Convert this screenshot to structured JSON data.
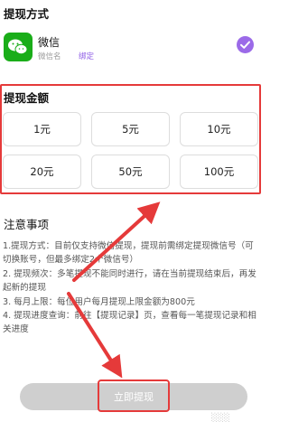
{
  "method": {
    "title": "提现方式",
    "wechat_label": "微信",
    "wechat_sub": "微信名",
    "bound_tag": "绑定"
  },
  "amount": {
    "title": "提现金额",
    "options": [
      "1元",
      "5元",
      "10元",
      "20元",
      "50元",
      "100元"
    ]
  },
  "notice": {
    "title": "注意事项",
    "items": [
      "1.提现方式：目前仅支持微信提现，提现前需绑定提现微信号（可切换账号，但最多绑定2个微信号）",
      "2. 提现频次：多笔提现不能同时进行，请在当前提现结束后，再发起新的提现",
      "3. 每月上限：每位用户每月提现上限金额为800元",
      "4. 提现进度查询：前往【提现记录】页，查看每一笔提现记录和相关进度"
    ]
  },
  "submit": {
    "label": "立即提现"
  },
  "colors": {
    "accent": "#9b6ae8",
    "annotation": "#e53a3a",
    "wechat": "#1aad19"
  }
}
